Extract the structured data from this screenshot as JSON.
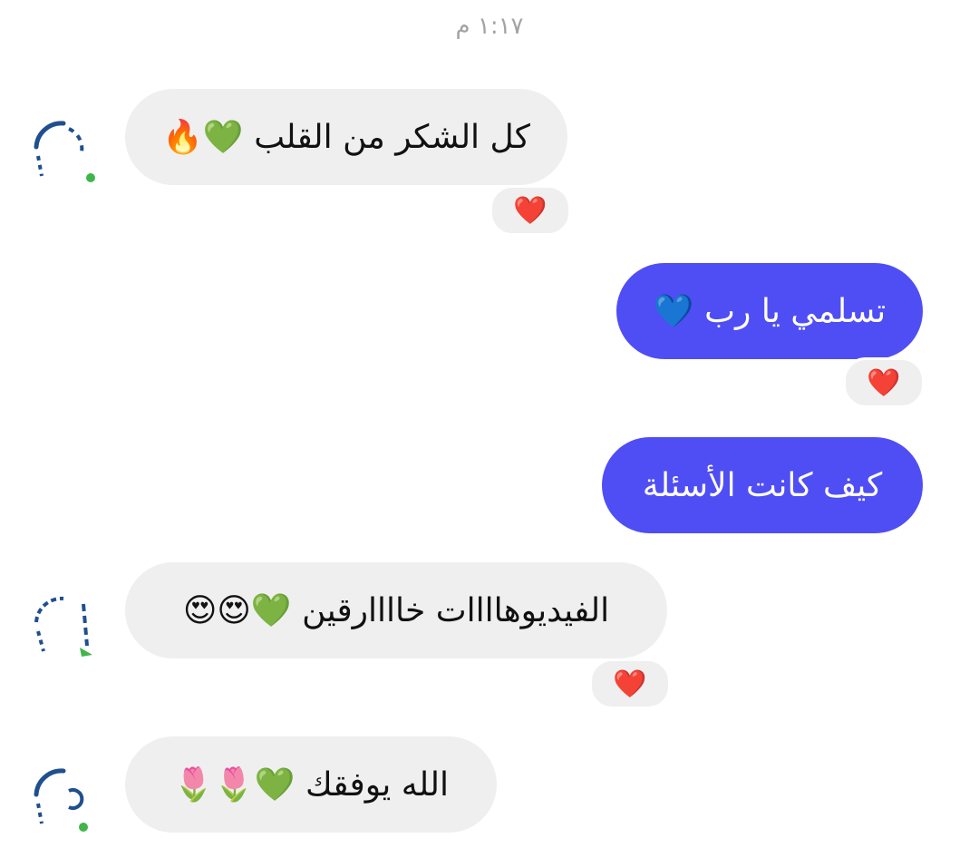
{
  "timestamp": "١:١٧ م",
  "messages": [
    {
      "text": "كل الشكر من القلب 💚🔥",
      "reaction": "❤️"
    },
    {
      "text": "تسلمي يا رب 💙",
      "reaction": "❤️"
    },
    {
      "text": "كيف كانت الأسئلة"
    },
    {
      "text": "الفيديوهاااات خاااارقين 💚😍😍",
      "reaction": "❤️"
    },
    {
      "text": "الله يوفقك 💚🌷🌷"
    }
  ],
  "colors": {
    "incoming_bubble": "#efefef",
    "outgoing_bubble": "#4f4ef4",
    "timestamp": "#a3a3a3"
  },
  "icons": [
    "avatar-icon",
    "heart-reaction-icon"
  ]
}
